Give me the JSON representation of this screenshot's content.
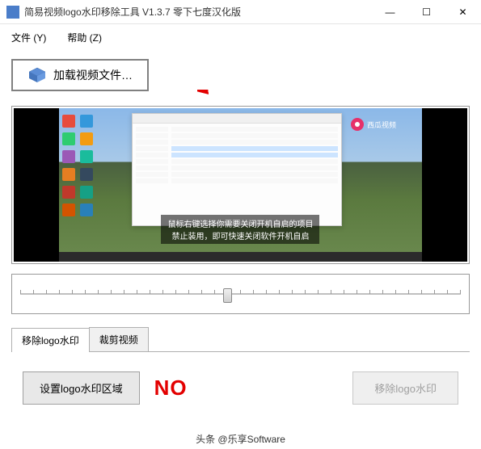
{
  "window": {
    "title": "简易视频logo水印移除工具 V1.3.7 零下七度汉化版"
  },
  "menu": {
    "file": "文件 (Y)",
    "help": "帮助 (Z)"
  },
  "toolbar": {
    "load_label": "加载视频文件…"
  },
  "preview": {
    "subtitle_line1": "鼠标右键选择你需要关闭开机自启的项目",
    "subtitle_line2": "禁止装用，即可快速关闭软件开机自启",
    "watermark_text": "西瓜视频"
  },
  "tabs": {
    "remove_logo": "移除logo水印",
    "crop_video": "裁剪视频"
  },
  "panel": {
    "set_area_label": "设置logo水印区域",
    "status_text": "NO",
    "remove_label": "移除logo水印"
  },
  "footer": {
    "author": "头条 @乐享Software"
  },
  "icons": {
    "minimize": "—",
    "maximize": "☐",
    "close": "✕"
  }
}
